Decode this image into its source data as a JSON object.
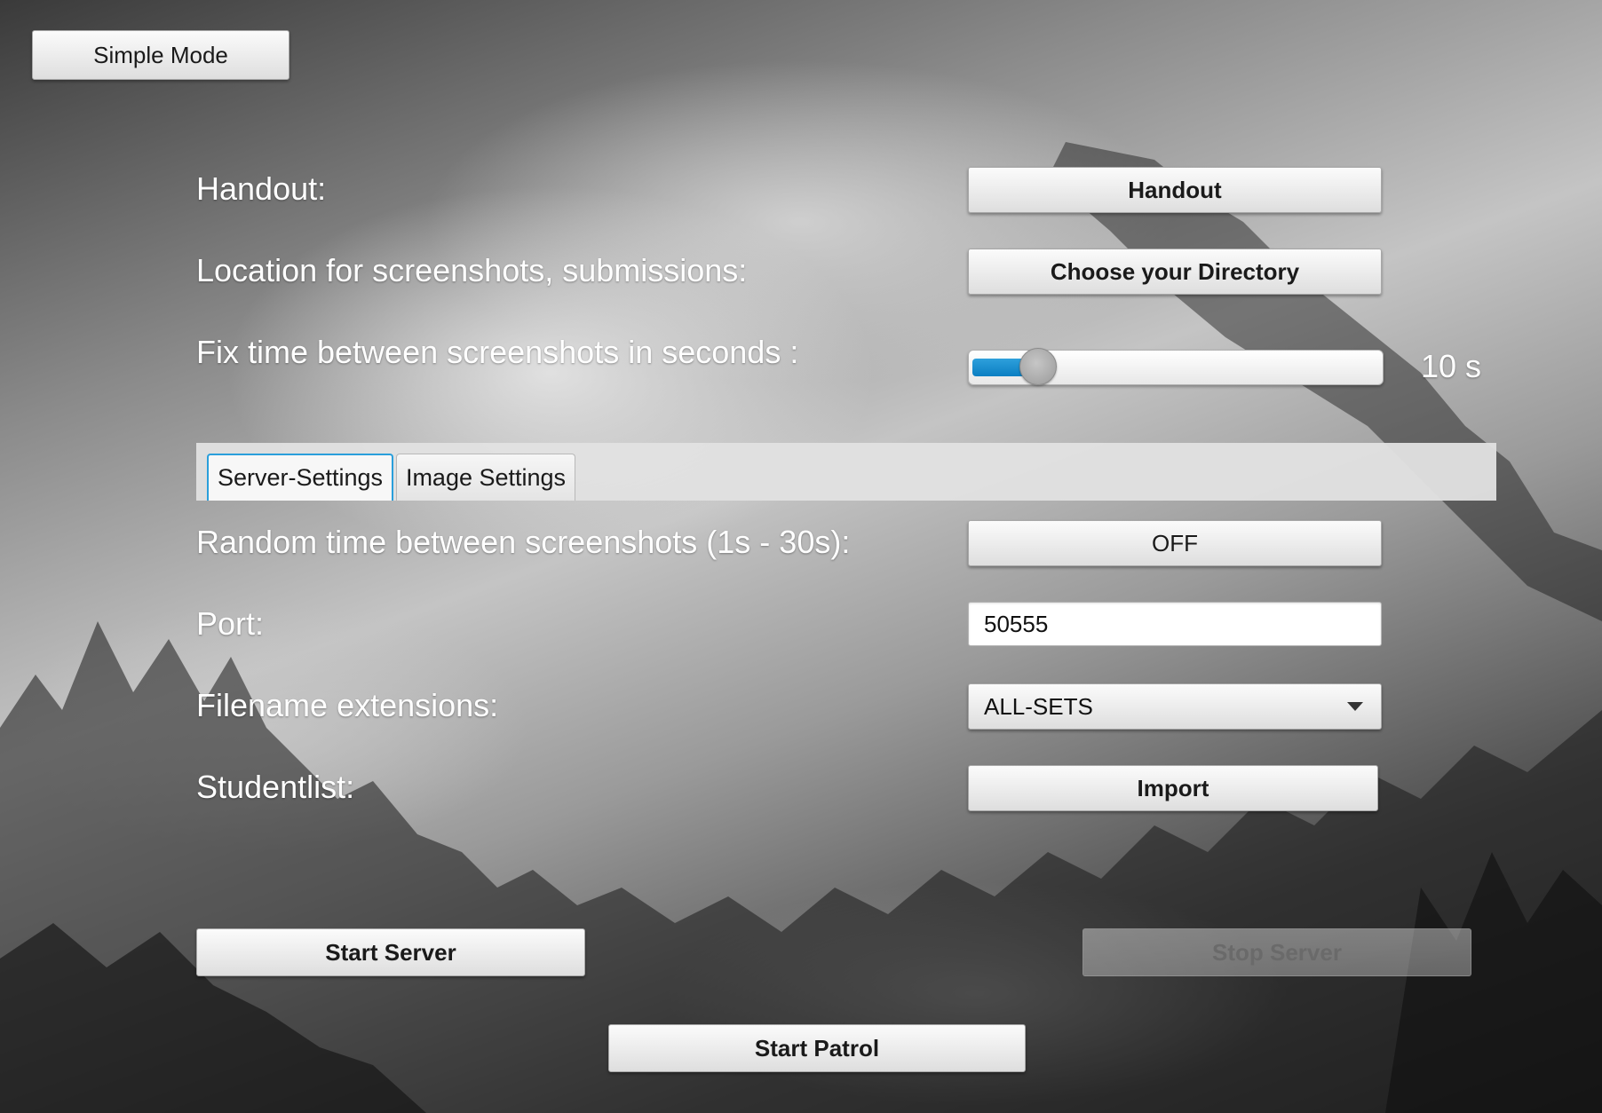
{
  "mode_button": {
    "label": "Simple Mode"
  },
  "handout": {
    "label": "Handout:",
    "button": "Handout"
  },
  "location": {
    "label": "Location for screenshots, submissions:",
    "button": "Choose your Directory"
  },
  "interval": {
    "label": "Fix time between screenshots in seconds :",
    "value_text": "10 s",
    "value": 10,
    "min": 1,
    "max": 60,
    "fill_fraction": 0.15
  },
  "tabs": [
    {
      "label": "Server-Settings",
      "active": true
    },
    {
      "label": "Image Settings",
      "active": false
    }
  ],
  "random_time": {
    "label": "Random time between screenshots (1s - 30s):",
    "button": "OFF"
  },
  "port": {
    "label": "Port:",
    "value": "50555"
  },
  "extensions": {
    "label": "Filename extensions:",
    "selected": "ALL-SETS"
  },
  "studentlist": {
    "label": "Studentlist:",
    "button": "Import"
  },
  "actions": {
    "start_server": "Start Server",
    "stop_server": "Stop Server",
    "start_patrol": "Start Patrol"
  },
  "colors": {
    "accent": "#2a9fdb",
    "slider_fill": "#0b7fc2",
    "label_text": "#ffffff"
  }
}
